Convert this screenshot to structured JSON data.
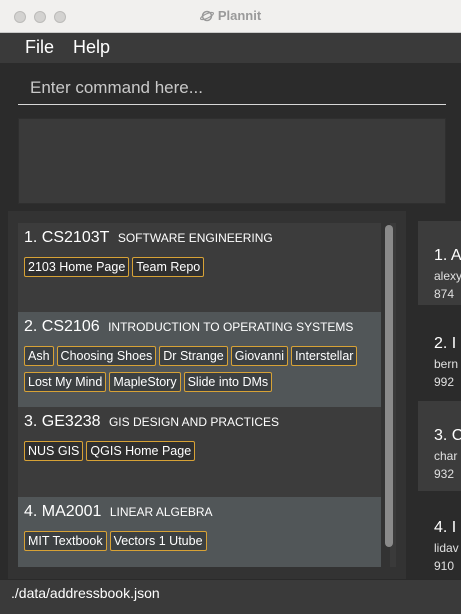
{
  "window": {
    "title": "Plannit",
    "title_icon": "planet-icon"
  },
  "menu": {
    "items": [
      {
        "label": "File"
      },
      {
        "label": "Help"
      }
    ]
  },
  "command": {
    "placeholder": "Enter command here...",
    "value": ""
  },
  "result": {
    "text": ""
  },
  "modules": [
    {
      "index": "1.",
      "code": "CS2103T",
      "title": "SOFTWARE ENGINEERING",
      "tags": [
        "2103 Home Page",
        "Team Repo"
      ]
    },
    {
      "index": "2.",
      "code": "CS2106",
      "title": "INTRODUCTION TO OPERATING SYSTEMS",
      "tags": [
        "Ash",
        "Choosing Shoes",
        "Dr Strange",
        "Giovanni",
        "Interstellar",
        "Lost My Mind",
        "MapleStory",
        "Slide into DMs"
      ]
    },
    {
      "index": "3.",
      "code": "GE3238",
      "title": "GIS DESIGN AND PRACTICES",
      "tags": [
        "NUS GIS",
        "QGIS Home Page"
      ]
    },
    {
      "index": "4.",
      "code": "MA2001",
      "title": "LINEAR ALGEBRA",
      "tags": [
        "MIT Textbook",
        "Vectors 1 Utube"
      ]
    }
  ],
  "persons": [
    {
      "index": "1.",
      "name": "A",
      "line1": "alexy",
      "line2": "874"
    },
    {
      "index": "2.",
      "name": "I",
      "line1": "bern",
      "line2": "992"
    },
    {
      "index": "3.",
      "name": "C",
      "line1": "char",
      "line2": "932"
    },
    {
      "index": "4.",
      "name": "I",
      "line1": "lidav",
      "line2": "910"
    }
  ],
  "status": {
    "path": "./data/addressbook.json"
  },
  "colors": {
    "tag_border": "#d7a236",
    "background": "#2b2b2b",
    "card_alt": "#515658"
  }
}
